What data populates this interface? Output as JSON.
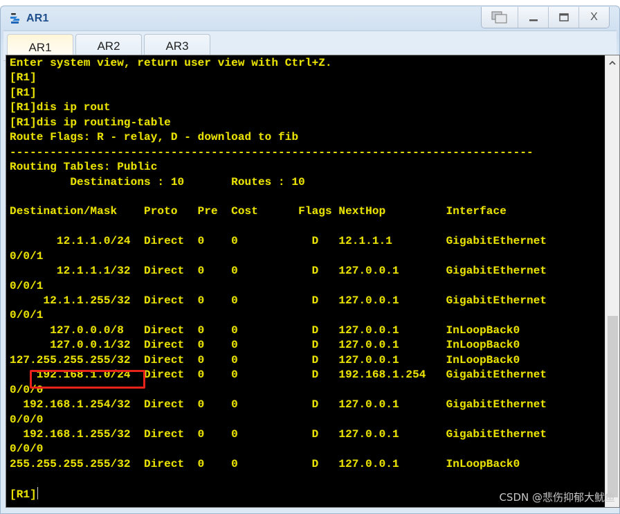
{
  "window": {
    "title": "AR1",
    "controls": {
      "restore_label": "❐",
      "minimize_label": "_",
      "maximize_label": "□",
      "close_label": "X"
    }
  },
  "tabs": [
    {
      "label": "AR1",
      "active": true
    },
    {
      "label": "AR2",
      "active": false
    },
    {
      "label": "AR3",
      "active": false
    }
  ],
  "terminal": {
    "lines": [
      "Enter system view, return user view with Ctrl+Z.",
      "[R1]",
      "[R1]",
      "[R1]dis ip rout",
      "[R1]dis ip routing-table",
      "Route Flags: R - relay, D - download to fib",
      "------------------------------------------------------------------------------",
      "Routing Tables: Public",
      "         Destinations : 10       Routes : 10",
      "",
      "Destination/Mask    Proto   Pre  Cost      Flags NextHop         Interface",
      "",
      "       12.1.1.0/24  Direct  0    0           D   12.1.1.1        GigabitEthernet",
      "0/0/1",
      "       12.1.1.1/32  Direct  0    0           D   127.0.0.1       GigabitEthernet",
      "0/0/1",
      "     12.1.1.255/32  Direct  0    0           D   127.0.0.1       GigabitEthernet",
      "0/0/1",
      "      127.0.0.0/8   Direct  0    0           D   127.0.0.1       InLoopBack0",
      "      127.0.0.1/32  Direct  0    0           D   127.0.0.1       InLoopBack0",
      "127.255.255.255/32  Direct  0    0           D   127.0.0.1       InLoopBack0",
      "    192.168.1.0/24  Direct  0    0           D   192.168.1.254   GigabitEthernet",
      "0/0/0",
      "  192.168.1.254/32  Direct  0    0           D   127.0.0.1       GigabitEthernet",
      "0/0/0",
      "  192.168.1.255/32  Direct  0    0           D   127.0.0.1       GigabitEthernet",
      "0/0/0",
      "255.255.255.255/32  Direct  0    0           D   127.0.0.1       InLoopBack0",
      "",
      "[R1]"
    ],
    "routing_summary": {
      "table": "Public",
      "destinations": 10,
      "routes": 10
    },
    "routing_table": {
      "columns": [
        "Destination/Mask",
        "Proto",
        "Pre",
        "Cost",
        "Flags",
        "NextHop",
        "Interface"
      ],
      "rows": [
        [
          "12.1.1.0/24",
          "Direct",
          "0",
          "0",
          "D",
          "12.1.1.1",
          "GigabitEthernet0/0/1"
        ],
        [
          "12.1.1.1/32",
          "Direct",
          "0",
          "0",
          "D",
          "127.0.0.1",
          "GigabitEthernet0/0/1"
        ],
        [
          "12.1.1.255/32",
          "Direct",
          "0",
          "0",
          "D",
          "127.0.0.1",
          "GigabitEthernet0/0/1"
        ],
        [
          "127.0.0.0/8",
          "Direct",
          "0",
          "0",
          "D",
          "127.0.0.1",
          "InLoopBack0"
        ],
        [
          "127.0.0.1/32",
          "Direct",
          "0",
          "0",
          "D",
          "127.0.0.1",
          "InLoopBack0"
        ],
        [
          "127.255.255.255/32",
          "Direct",
          "0",
          "0",
          "D",
          "127.0.0.1",
          "InLoopBack0"
        ],
        [
          "192.168.1.0/24",
          "Direct",
          "0",
          "0",
          "D",
          "192.168.1.254",
          "GigabitEthernet0/0/0"
        ],
        [
          "192.168.1.254/32",
          "Direct",
          "0",
          "0",
          "D",
          "127.0.0.1",
          "GigabitEthernet0/0/0"
        ],
        [
          "192.168.1.255/32",
          "Direct",
          "0",
          "0",
          "D",
          "127.0.0.1",
          "GigabitEthernet0/0/0"
        ],
        [
          "255.255.255.255/32",
          "Direct",
          "0",
          "0",
          "D",
          "127.0.0.1",
          "InLoopBack0"
        ]
      ]
    },
    "highlighted_entry": "192.168.1.0/24",
    "prompt": "[R1]",
    "colors": {
      "text": "#e8e000",
      "background": "#000000",
      "highlight_box": "#e8231c"
    }
  },
  "scrollbar": {
    "up_arrow": "^"
  },
  "watermark": "CSDN @悲伤抑郁大鱿鱼"
}
